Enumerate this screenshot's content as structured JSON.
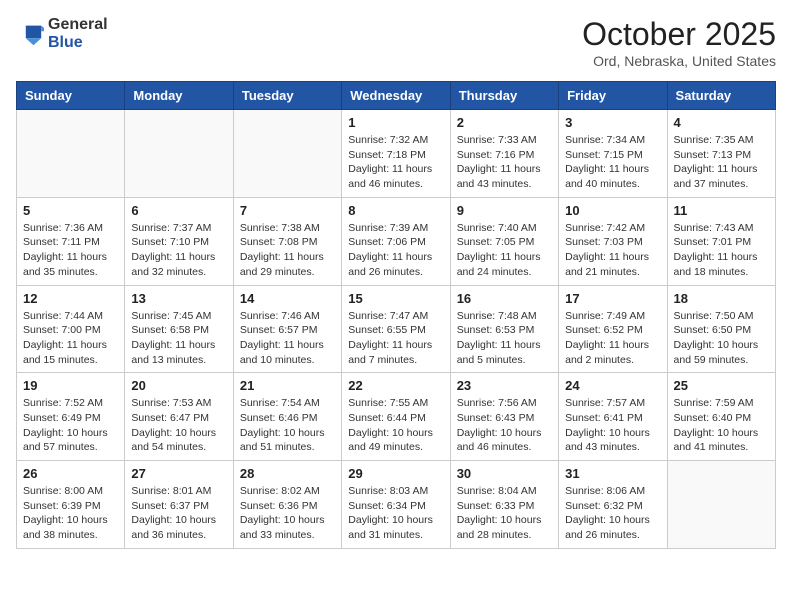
{
  "logo": {
    "general": "General",
    "blue": "Blue"
  },
  "title": "October 2025",
  "location": "Ord, Nebraska, United States",
  "days_of_week": [
    "Sunday",
    "Monday",
    "Tuesday",
    "Wednesday",
    "Thursday",
    "Friday",
    "Saturday"
  ],
  "weeks": [
    [
      {
        "day": "",
        "info": ""
      },
      {
        "day": "",
        "info": ""
      },
      {
        "day": "",
        "info": ""
      },
      {
        "day": "1",
        "info": "Sunrise: 7:32 AM\nSunset: 7:18 PM\nDaylight: 11 hours\nand 46 minutes."
      },
      {
        "day": "2",
        "info": "Sunrise: 7:33 AM\nSunset: 7:16 PM\nDaylight: 11 hours\nand 43 minutes."
      },
      {
        "day": "3",
        "info": "Sunrise: 7:34 AM\nSunset: 7:15 PM\nDaylight: 11 hours\nand 40 minutes."
      },
      {
        "day": "4",
        "info": "Sunrise: 7:35 AM\nSunset: 7:13 PM\nDaylight: 11 hours\nand 37 minutes."
      }
    ],
    [
      {
        "day": "5",
        "info": "Sunrise: 7:36 AM\nSunset: 7:11 PM\nDaylight: 11 hours\nand 35 minutes."
      },
      {
        "day": "6",
        "info": "Sunrise: 7:37 AM\nSunset: 7:10 PM\nDaylight: 11 hours\nand 32 minutes."
      },
      {
        "day": "7",
        "info": "Sunrise: 7:38 AM\nSunset: 7:08 PM\nDaylight: 11 hours\nand 29 minutes."
      },
      {
        "day": "8",
        "info": "Sunrise: 7:39 AM\nSunset: 7:06 PM\nDaylight: 11 hours\nand 26 minutes."
      },
      {
        "day": "9",
        "info": "Sunrise: 7:40 AM\nSunset: 7:05 PM\nDaylight: 11 hours\nand 24 minutes."
      },
      {
        "day": "10",
        "info": "Sunrise: 7:42 AM\nSunset: 7:03 PM\nDaylight: 11 hours\nand 21 minutes."
      },
      {
        "day": "11",
        "info": "Sunrise: 7:43 AM\nSunset: 7:01 PM\nDaylight: 11 hours\nand 18 minutes."
      }
    ],
    [
      {
        "day": "12",
        "info": "Sunrise: 7:44 AM\nSunset: 7:00 PM\nDaylight: 11 hours\nand 15 minutes."
      },
      {
        "day": "13",
        "info": "Sunrise: 7:45 AM\nSunset: 6:58 PM\nDaylight: 11 hours\nand 13 minutes."
      },
      {
        "day": "14",
        "info": "Sunrise: 7:46 AM\nSunset: 6:57 PM\nDaylight: 11 hours\nand 10 minutes."
      },
      {
        "day": "15",
        "info": "Sunrise: 7:47 AM\nSunset: 6:55 PM\nDaylight: 11 hours\nand 7 minutes."
      },
      {
        "day": "16",
        "info": "Sunrise: 7:48 AM\nSunset: 6:53 PM\nDaylight: 11 hours\nand 5 minutes."
      },
      {
        "day": "17",
        "info": "Sunrise: 7:49 AM\nSunset: 6:52 PM\nDaylight: 11 hours\nand 2 minutes."
      },
      {
        "day": "18",
        "info": "Sunrise: 7:50 AM\nSunset: 6:50 PM\nDaylight: 10 hours\nand 59 minutes."
      }
    ],
    [
      {
        "day": "19",
        "info": "Sunrise: 7:52 AM\nSunset: 6:49 PM\nDaylight: 10 hours\nand 57 minutes."
      },
      {
        "day": "20",
        "info": "Sunrise: 7:53 AM\nSunset: 6:47 PM\nDaylight: 10 hours\nand 54 minutes."
      },
      {
        "day": "21",
        "info": "Sunrise: 7:54 AM\nSunset: 6:46 PM\nDaylight: 10 hours\nand 51 minutes."
      },
      {
        "day": "22",
        "info": "Sunrise: 7:55 AM\nSunset: 6:44 PM\nDaylight: 10 hours\nand 49 minutes."
      },
      {
        "day": "23",
        "info": "Sunrise: 7:56 AM\nSunset: 6:43 PM\nDaylight: 10 hours\nand 46 minutes."
      },
      {
        "day": "24",
        "info": "Sunrise: 7:57 AM\nSunset: 6:41 PM\nDaylight: 10 hours\nand 43 minutes."
      },
      {
        "day": "25",
        "info": "Sunrise: 7:59 AM\nSunset: 6:40 PM\nDaylight: 10 hours\nand 41 minutes."
      }
    ],
    [
      {
        "day": "26",
        "info": "Sunrise: 8:00 AM\nSunset: 6:39 PM\nDaylight: 10 hours\nand 38 minutes."
      },
      {
        "day": "27",
        "info": "Sunrise: 8:01 AM\nSunset: 6:37 PM\nDaylight: 10 hours\nand 36 minutes."
      },
      {
        "day": "28",
        "info": "Sunrise: 8:02 AM\nSunset: 6:36 PM\nDaylight: 10 hours\nand 33 minutes."
      },
      {
        "day": "29",
        "info": "Sunrise: 8:03 AM\nSunset: 6:34 PM\nDaylight: 10 hours\nand 31 minutes."
      },
      {
        "day": "30",
        "info": "Sunrise: 8:04 AM\nSunset: 6:33 PM\nDaylight: 10 hours\nand 28 minutes."
      },
      {
        "day": "31",
        "info": "Sunrise: 8:06 AM\nSunset: 6:32 PM\nDaylight: 10 hours\nand 26 minutes."
      },
      {
        "day": "",
        "info": ""
      }
    ]
  ]
}
